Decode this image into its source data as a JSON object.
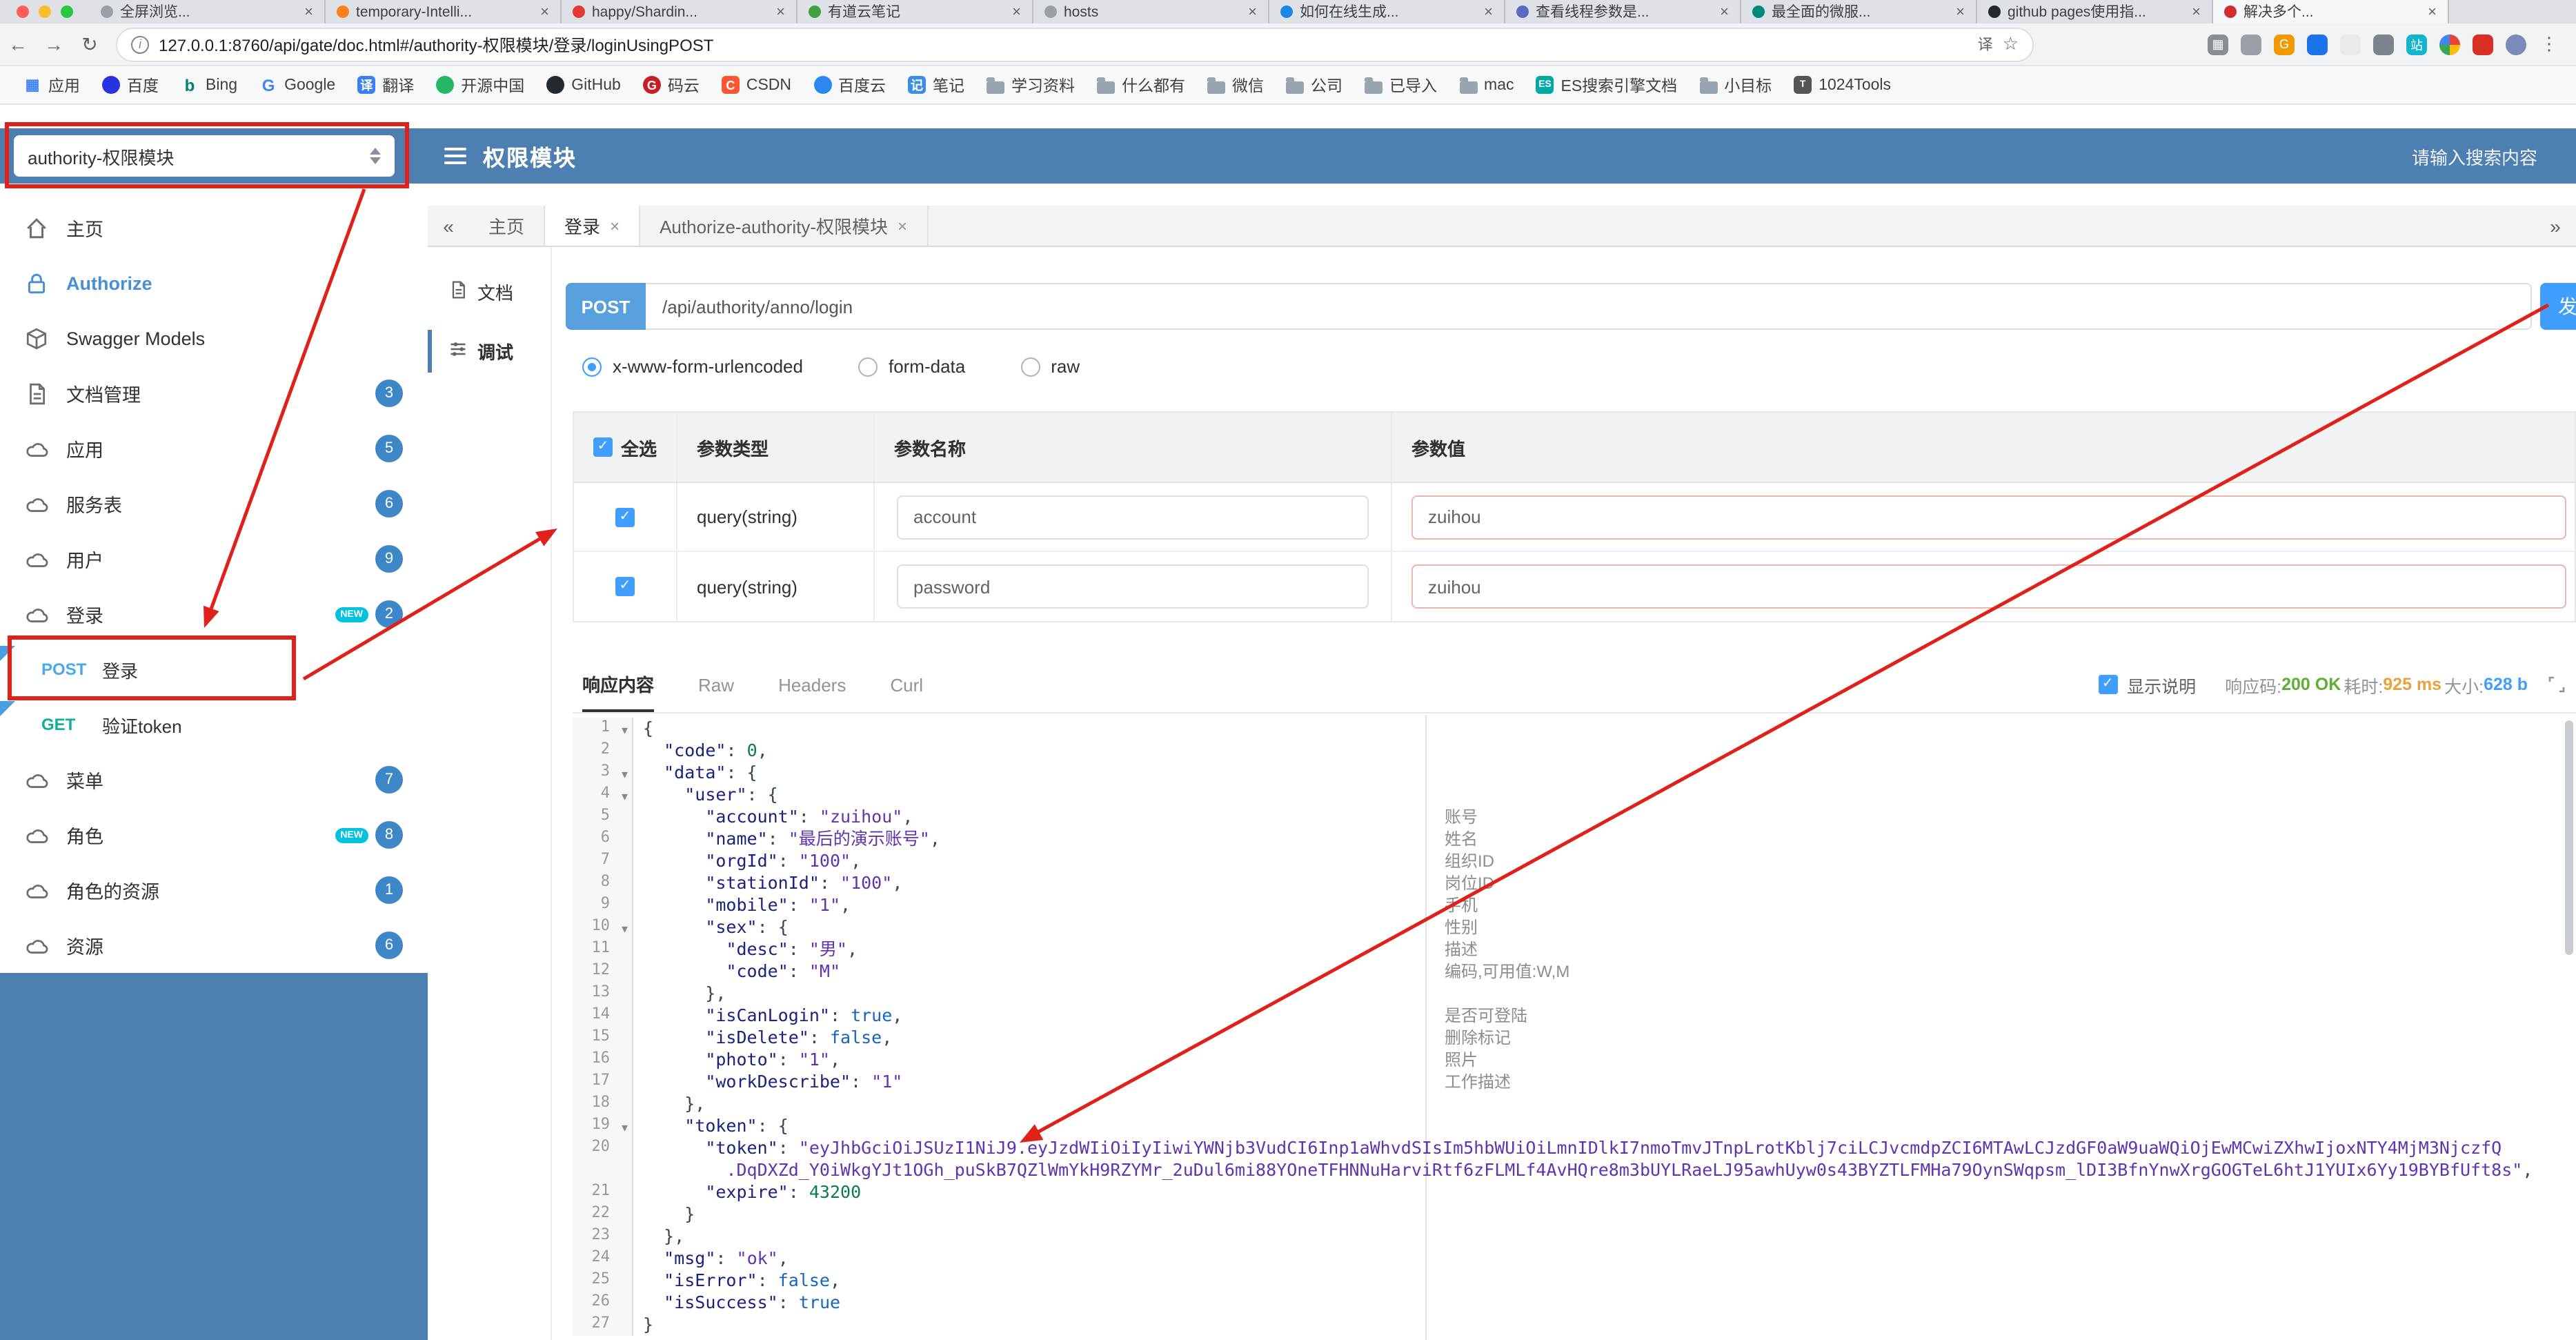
{
  "theme": {
    "header_blue": "#4d7fb0",
    "accent_blue": "#409eff",
    "annotation_red": "#e0211a"
  },
  "browser": {
    "traffic_lights": [
      "#ff5f57",
      "#febc2e",
      "#28c840"
    ],
    "tabs": [
      {
        "title": "全屏浏览...",
        "color": "#9aa0a6"
      },
      {
        "title": "temporary-Intelli...",
        "color": "#fc801d"
      },
      {
        "title": "happy/Shardin...",
        "color": "#e53935"
      },
      {
        "title": "有道云笔记",
        "color": "#43a047"
      },
      {
        "title": "hosts",
        "color": "#9aa0a6"
      },
      {
        "title": "如何在线生成...",
        "color": "#1e88e5"
      },
      {
        "title": "查看线程参数是...",
        "color": "#5c6bc0"
      },
      {
        "title": "最全面的微服...",
        "color": "#00897b"
      },
      {
        "title": "github pages使用指...",
        "color": "#24292e"
      },
      {
        "title": "解决多个...",
        "color": "#d32f2f"
      }
    ],
    "url": "127.0.0.1:8760/api/gate/doc.html#/authority-权限模块/登录/loginUsingPOST",
    "omnibox_icons": [
      {
        "name": "translate",
        "glyph": "译"
      },
      {
        "name": "bookmark-star",
        "glyph": "☆"
      }
    ],
    "toolbar_icons": [
      {
        "name": "grid",
        "glyph": "▦",
        "color": "#8a8f96"
      },
      {
        "name": "puzzle",
        "glyph": "",
        "color": "#9aa0a6"
      },
      {
        "name": "ext-orange",
        "glyph": "G",
        "color": "#f29900"
      },
      {
        "name": "ext-blue",
        "glyph": "",
        "color": "#1a73e8"
      },
      {
        "name": "ext-light",
        "glyph": "",
        "color": "#e8eaed"
      },
      {
        "name": "ext-shield",
        "glyph": "",
        "color": "#7d838a"
      },
      {
        "name": "ext-teal",
        "glyph": "站",
        "color": "#12b5cb"
      },
      {
        "name": "pinwheel",
        "glyph": "",
        "color": "conic"
      },
      {
        "name": "ext-red",
        "glyph": "",
        "color": "#d93025"
      },
      {
        "name": "avatar",
        "glyph": "",
        "color": "#7b8ab8"
      },
      {
        "name": "kebab-menu",
        "glyph": "⋮",
        "color": "#5f6368"
      }
    ],
    "bookmarks": [
      {
        "label": "应用",
        "icon": "apps",
        "glyph": "▦"
      },
      {
        "label": "百度",
        "icon": "dot-blue",
        "glyph": ""
      },
      {
        "label": "Bing",
        "icon": "b-blue",
        "glyph": "b"
      },
      {
        "label": "Google",
        "icon": "g-multi",
        "glyph": "G"
      },
      {
        "label": "翻译",
        "icon": "trans",
        "glyph": "译"
      },
      {
        "label": "开源中国",
        "icon": "dot-green",
        "glyph": ""
      },
      {
        "label": "GitHub",
        "icon": "dot-black",
        "glyph": ""
      },
      {
        "label": "码云",
        "icon": "g-red",
        "glyph": "G"
      },
      {
        "label": "CSDN",
        "icon": "c-red",
        "glyph": "C"
      },
      {
        "label": "百度云",
        "icon": "cloud-blue",
        "glyph": ""
      },
      {
        "label": "笔记",
        "icon": "note-blue",
        "glyph": "记"
      },
      {
        "label": "学习资料",
        "icon": "folder",
        "glyph": ""
      },
      {
        "label": "什么都有",
        "icon": "folder",
        "glyph": ""
      },
      {
        "label": "微信",
        "icon": "folder",
        "glyph": ""
      },
      {
        "label": "公司",
        "icon": "folder",
        "glyph": ""
      },
      {
        "label": "已导入",
        "icon": "folder",
        "glyph": ""
      },
      {
        "label": "mac",
        "icon": "folder",
        "glyph": ""
      },
      {
        "label": "ES搜索引擎文档",
        "icon": "es",
        "glyph": "ES"
      },
      {
        "label": "小目标",
        "icon": "folder",
        "glyph": ""
      },
      {
        "label": "1024Tools",
        "icon": "tools",
        "glyph": "T"
      }
    ]
  },
  "header": {
    "module_select": "authority-权限模块",
    "title": "权限模块",
    "search_placeholder": "请输入搜索内容"
  },
  "sidebar": {
    "items": [
      {
        "label": "主页",
        "icon": "home"
      },
      {
        "label": "Authorize",
        "icon": "lock",
        "active": true
      },
      {
        "label": "Swagger Models",
        "icon": "models"
      },
      {
        "label": "文档管理",
        "icon": "docs",
        "badge": "3"
      },
      {
        "label": "应用",
        "icon": "group",
        "badge": "5"
      },
      {
        "label": "服务表",
        "icon": "group",
        "badge": "6"
      },
      {
        "label": "用户",
        "icon": "group",
        "badge": "9"
      },
      {
        "label": "登录",
        "icon": "group",
        "badge": "2",
        "isNew": true
      },
      {
        "op": true,
        "method": "POST",
        "label": "登录"
      },
      {
        "op": true,
        "method": "GET",
        "label": "验证token"
      },
      {
        "label": "菜单",
        "icon": "group",
        "badge": "7"
      },
      {
        "label": "角色",
        "icon": "group",
        "badge": "8",
        "isNew": true
      },
      {
        "label": "角色的资源",
        "icon": "group",
        "badge": "1"
      },
      {
        "label": "资源",
        "icon": "group",
        "badge": "6"
      }
    ]
  },
  "workspace": {
    "collapse_left": "«",
    "collapse_right": "»",
    "tabs": [
      {
        "label": "主页",
        "closable": false,
        "active": false
      },
      {
        "label": "登录",
        "closable": true,
        "active": true
      },
      {
        "label": "Authorize-authority-权限模块",
        "closable": true,
        "active": false
      }
    ],
    "doc_nav": [
      {
        "label": "文档",
        "icon": "doc",
        "active": false
      },
      {
        "label": "调试",
        "icon": "debug",
        "active": true
      }
    ]
  },
  "request": {
    "method": "POST",
    "path": "/api/authority/anno/login",
    "send_button": "发",
    "content_types": [
      {
        "label": "x-www-form-urlencoded",
        "selected": true
      },
      {
        "label": "form-data",
        "selected": false
      },
      {
        "label": "raw",
        "selected": false
      }
    ]
  },
  "params": {
    "select_all": "全选",
    "col_type": "参数类型",
    "col_name": "参数名称",
    "col_value": "参数值",
    "rows": [
      {
        "checked": true,
        "type": "query(string)",
        "name": "account",
        "value": "zuihou"
      },
      {
        "checked": true,
        "type": "query(string)",
        "name": "password",
        "value": "zuihou"
      }
    ]
  },
  "response": {
    "tabs": [
      {
        "label": "响应内容",
        "active": true
      },
      {
        "label": "Raw",
        "active": false
      },
      {
        "label": "Headers",
        "active": false
      },
      {
        "label": "Curl",
        "active": false
      }
    ],
    "show_desc": "显示说明",
    "meta": [
      {
        "label": "响应码:",
        "value": "200 OK",
        "color": "#5daf34"
      },
      {
        "label": "耗时:",
        "value": "925 ms",
        "color": "#e6a23c"
      },
      {
        "label": "大小:",
        "value": "628 b",
        "color": "#409eff"
      }
    ]
  },
  "code": {
    "lines": [
      {
        "n": "1",
        "f": 1,
        "segs": [
          [
            "p",
            "{"
          ]
        ]
      },
      {
        "n": "2",
        "segs": [
          [
            "p",
            "  "
          ],
          [
            "k",
            "\"code\""
          ],
          [
            "p",
            ": "
          ],
          [
            "num",
            "0"
          ],
          [
            "p",
            ","
          ]
        ]
      },
      {
        "n": "3",
        "f": 1,
        "segs": [
          [
            "p",
            "  "
          ],
          [
            "k",
            "\"data\""
          ],
          [
            "p",
            ": {"
          ]
        ]
      },
      {
        "n": "4",
        "f": 1,
        "segs": [
          [
            "p",
            "    "
          ],
          [
            "k",
            "\"user\""
          ],
          [
            "p",
            ": {"
          ]
        ]
      },
      {
        "n": "5",
        "segs": [
          [
            "p",
            "      "
          ],
          [
            "k",
            "\"account\""
          ],
          [
            "p",
            ": "
          ],
          [
            "s",
            "\"zuihou\""
          ],
          [
            "p",
            ","
          ]
        ]
      },
      {
        "n": "6",
        "segs": [
          [
            "p",
            "      "
          ],
          [
            "k",
            "\"name\""
          ],
          [
            "p",
            ": "
          ],
          [
            "s",
            "\"最后的演示账号\""
          ],
          [
            "p",
            ","
          ]
        ]
      },
      {
        "n": "7",
        "segs": [
          [
            "p",
            "      "
          ],
          [
            "k",
            "\"orgId\""
          ],
          [
            "p",
            ": "
          ],
          [
            "s",
            "\"100\""
          ],
          [
            "p",
            ","
          ]
        ]
      },
      {
        "n": "8",
        "segs": [
          [
            "p",
            "      "
          ],
          [
            "k",
            "\"stationId\""
          ],
          [
            "p",
            ": "
          ],
          [
            "s",
            "\"100\""
          ],
          [
            "p",
            ","
          ]
        ]
      },
      {
        "n": "9",
        "segs": [
          [
            "p",
            "      "
          ],
          [
            "k",
            "\"mobile\""
          ],
          [
            "p",
            ": "
          ],
          [
            "s",
            "\"1\""
          ],
          [
            "p",
            ","
          ]
        ]
      },
      {
        "n": "10",
        "f": 1,
        "segs": [
          [
            "p",
            "      "
          ],
          [
            "k",
            "\"sex\""
          ],
          [
            "p",
            ": {"
          ]
        ]
      },
      {
        "n": "11",
        "segs": [
          [
            "p",
            "        "
          ],
          [
            "k",
            "\"desc\""
          ],
          [
            "p",
            ": "
          ],
          [
            "s",
            "\"男\""
          ],
          [
            "p",
            ","
          ]
        ]
      },
      {
        "n": "12",
        "segs": [
          [
            "p",
            "        "
          ],
          [
            "k",
            "\"code\""
          ],
          [
            "p",
            ": "
          ],
          [
            "s",
            "\"M\""
          ]
        ]
      },
      {
        "n": "13",
        "segs": [
          [
            "p",
            "      },"
          ]
        ]
      },
      {
        "n": "14",
        "segs": [
          [
            "p",
            "      "
          ],
          [
            "k",
            "\"isCanLogin\""
          ],
          [
            "p",
            ": "
          ],
          [
            "bool",
            "true"
          ],
          [
            "p",
            ","
          ]
        ]
      },
      {
        "n": "15",
        "segs": [
          [
            "p",
            "      "
          ],
          [
            "k",
            "\"isDelete\""
          ],
          [
            "p",
            ": "
          ],
          [
            "bool",
            "false"
          ],
          [
            "p",
            ","
          ]
        ]
      },
      {
        "n": "16",
        "segs": [
          [
            "p",
            "      "
          ],
          [
            "k",
            "\"photo\""
          ],
          [
            "p",
            ": "
          ],
          [
            "s",
            "\"1\""
          ],
          [
            "p",
            ","
          ]
        ]
      },
      {
        "n": "17",
        "segs": [
          [
            "p",
            "      "
          ],
          [
            "k",
            "\"workDescribe\""
          ],
          [
            "p",
            ": "
          ],
          [
            "s",
            "\"1\""
          ]
        ]
      },
      {
        "n": "18",
        "segs": [
          [
            "p",
            "    },"
          ]
        ]
      },
      {
        "n": "19",
        "f": 1,
        "segs": [
          [
            "p",
            "    "
          ],
          [
            "k",
            "\"token\""
          ],
          [
            "p",
            ": {"
          ]
        ]
      },
      {
        "n": "20",
        "segs": [
          [
            "p",
            "      "
          ],
          [
            "k",
            "\"token\""
          ],
          [
            "p",
            ": "
          ],
          [
            "s",
            "\"eyJhbGciOiJSUzI1NiJ9.eyJzdWIiOiIyIiwiYWNjb3VudCI6Inp1aWhvdSIsIm5hbWUiOiLmnIDlkI7nmoTmvJTnpLrotKblj7ciLCJvcmdpZCI6MTAwLCJzdGF0aW9uaWQiOjEwMCwiZXhwIjoxNTY4MjM3NjczfQ"
          ]
        ]
      },
      {
        "n": "",
        "segs": [
          [
            "p",
            "        "
          ],
          [
            "s",
            ".DqDXZd_Y0iWkgYJt1OGh_puSkB7QZlWmYkH9RZYMr_2uDul6mi88YOneTFHNNuHarviRtf6zFLMLf4AvHQre8m3bUYLRaeLJ95awhUyw0s43BYZTLFMHa79OynSWqpsm_lDI3BfnYnwXrgGOGTeL6htJ1YUIx6Yy19BYBfUft8s\""
          ],
          [
            "p",
            ","
          ]
        ]
      },
      {
        "n": "21",
        "segs": [
          [
            "p",
            "      "
          ],
          [
            "k",
            "\"expire\""
          ],
          [
            "p",
            ": "
          ],
          [
            "num",
            "43200"
          ]
        ]
      },
      {
        "n": "22",
        "segs": [
          [
            "p",
            "    }"
          ]
        ]
      },
      {
        "n": "23",
        "segs": [
          [
            "p",
            "  },"
          ]
        ]
      },
      {
        "n": "24",
        "segs": [
          [
            "p",
            "  "
          ],
          [
            "k",
            "\"msg\""
          ],
          [
            "p",
            ": "
          ],
          [
            "s",
            "\"ok\""
          ],
          [
            "p",
            ","
          ]
        ]
      },
      {
        "n": "25",
        "segs": [
          [
            "p",
            "  "
          ],
          [
            "k",
            "\"isError\""
          ],
          [
            "p",
            ": "
          ],
          [
            "bool",
            "false"
          ],
          [
            "p",
            ","
          ]
        ]
      },
      {
        "n": "26",
        "segs": [
          [
            "p",
            "  "
          ],
          [
            "k",
            "\"isSuccess\""
          ],
          [
            "p",
            ": "
          ],
          [
            "bool",
            "true"
          ]
        ]
      },
      {
        "n": "27",
        "segs": [
          [
            "p",
            "}"
          ]
        ]
      }
    ],
    "annotations": [
      {
        "line": 5,
        "text": "账号"
      },
      {
        "line": 6,
        "text": "姓名"
      },
      {
        "line": 7,
        "text": "组织ID"
      },
      {
        "line": 8,
        "text": "岗位ID"
      },
      {
        "line": 9,
        "text": "手机"
      },
      {
        "line": 10,
        "text": "性别"
      },
      {
        "line": 11,
        "text": "描述"
      },
      {
        "line": 12,
        "text": "编码,可用值:W,M"
      },
      {
        "line": 14,
        "text": "是否可登陆"
      },
      {
        "line": 15,
        "text": "删除标记"
      },
      {
        "line": 16,
        "text": "照片"
      },
      {
        "line": 17,
        "text": "工作描述"
      }
    ]
  }
}
